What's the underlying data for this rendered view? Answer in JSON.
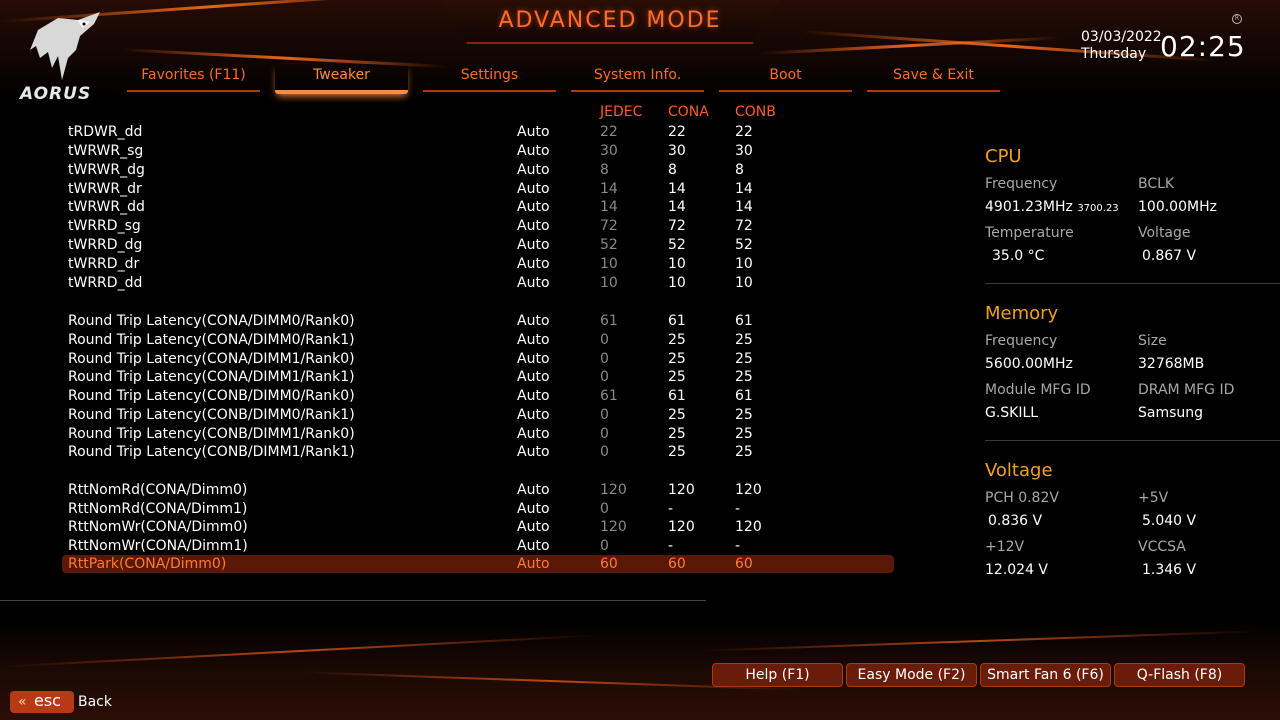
{
  "header": {
    "title": "ADVANCED MODE",
    "logo_text": "AORUS",
    "date": "03/03/2022",
    "day": "Thursday",
    "time": "02:25"
  },
  "tabs": [
    {
      "label": "Favorites (F11)",
      "active": false
    },
    {
      "label": "Tweaker",
      "active": true
    },
    {
      "label": "Settings",
      "active": false
    },
    {
      "label": "System Info.",
      "active": false
    },
    {
      "label": "Boot",
      "active": false
    },
    {
      "label": "Save & Exit",
      "active": false
    }
  ],
  "columns": {
    "jedec": "JEDEC",
    "cona": "CONA",
    "conb": "CONB"
  },
  "rows": [
    {
      "name": "tRDWR_dd",
      "value": "Auto",
      "jedec": "22",
      "cona": "22",
      "conb": "22"
    },
    {
      "name": "tWRWR_sg",
      "value": "Auto",
      "jedec": "30",
      "cona": "30",
      "conb": "30"
    },
    {
      "name": "tWRWR_dg",
      "value": "Auto",
      "jedec": "8",
      "cona": "8",
      "conb": "8"
    },
    {
      "name": "tWRWR_dr",
      "value": "Auto",
      "jedec": "14",
      "cona": "14",
      "conb": "14"
    },
    {
      "name": "tWRWR_dd",
      "value": "Auto",
      "jedec": "14",
      "cona": "14",
      "conb": "14"
    },
    {
      "name": "tWRRD_sg",
      "value": "Auto",
      "jedec": "72",
      "cona": "72",
      "conb": "72"
    },
    {
      "name": "tWRRD_dg",
      "value": "Auto",
      "jedec": "52",
      "cona": "52",
      "conb": "52"
    },
    {
      "name": "tWRRD_dr",
      "value": "Auto",
      "jedec": "10",
      "cona": "10",
      "conb": "10"
    },
    {
      "name": "tWRRD_dd",
      "value": "Auto",
      "jedec": "10",
      "cona": "10",
      "conb": "10"
    },
    {
      "name": "Round Trip Latency(CONA/DIMM0/Rank0)",
      "value": "Auto",
      "jedec": "61",
      "cona": "61",
      "conb": "61"
    },
    {
      "name": "Round Trip Latency(CONA/DIMM0/Rank1)",
      "value": "Auto",
      "jedec": "0",
      "cona": "25",
      "conb": "25"
    },
    {
      "name": "Round Trip Latency(CONA/DIMM1/Rank0)",
      "value": "Auto",
      "jedec": "0",
      "cona": "25",
      "conb": "25"
    },
    {
      "name": "Round Trip Latency(CONA/DIMM1/Rank1)",
      "value": "Auto",
      "jedec": "0",
      "cona": "25",
      "conb": "25"
    },
    {
      "name": "Round Trip Latency(CONB/DIMM0/Rank0)",
      "value": "Auto",
      "jedec": "61",
      "cona": "61",
      "conb": "61"
    },
    {
      "name": "Round Trip Latency(CONB/DIMM0/Rank1)",
      "value": "Auto",
      "jedec": "0",
      "cona": "25",
      "conb": "25"
    },
    {
      "name": "Round Trip Latency(CONB/DIMM1/Rank0)",
      "value": "Auto",
      "jedec": "0",
      "cona": "25",
      "conb": "25"
    },
    {
      "name": "Round Trip Latency(CONB/DIMM1/Rank1)",
      "value": "Auto",
      "jedec": "0",
      "cona": "25",
      "conb": "25"
    },
    {
      "name": "RttNomRd(CONA/Dimm0)",
      "value": "Auto",
      "jedec": "120",
      "cona": "120",
      "conb": "120"
    },
    {
      "name": "RttNomRd(CONA/Dimm1)",
      "value": "Auto",
      "jedec": "0",
      "cona": "-",
      "conb": "-"
    },
    {
      "name": "RttNomWr(CONA/Dimm0)",
      "value": "Auto",
      "jedec": "120",
      "cona": "120",
      "conb": "120"
    },
    {
      "name": "RttNomWr(CONA/Dimm1)",
      "value": "Auto",
      "jedec": "0",
      "cona": "-",
      "conb": "-"
    },
    {
      "name": "RttPark(CONA/Dimm0)",
      "value": "Auto",
      "jedec": "60",
      "cona": "60",
      "conb": "60",
      "selected": true
    }
  ],
  "sidebar": {
    "cpu": {
      "title": "CPU",
      "freq_label": "Frequency",
      "freq_value": "4901.23MHz",
      "freq_sub": "3700.23",
      "bclk_label": "BCLK",
      "bclk_value": "100.00MHz",
      "temp_label": "Temperature",
      "temp_value": "35.0 °C",
      "volt_label": "Voltage",
      "volt_value": "0.867 V"
    },
    "memory": {
      "title": "Memory",
      "freq_label": "Frequency",
      "freq_value": "5600.00MHz",
      "size_label": "Size",
      "size_value": "32768MB",
      "module_label": "Module MFG ID",
      "module_value": "G.SKILL",
      "dram_label": "DRAM MFG ID",
      "dram_value": "Samsung"
    },
    "voltage": {
      "title": "Voltage",
      "pch_label": "PCH 0.82V",
      "pch_value": "0.836 V",
      "p5_label": "+5V",
      "p5_value": "5.040 V",
      "p12_label": "+12V",
      "p12_value": "12.024 V",
      "vccsa_label": "VCCSA",
      "vccsa_value": "1.346 V"
    }
  },
  "footer": {
    "help": "Help (F1)",
    "easy": "Easy Mode (F2)",
    "smartfan": "Smart Fan 6 (F6)",
    "qflash": "Q-Flash (F8)",
    "esc": "esc",
    "back": "Back"
  }
}
